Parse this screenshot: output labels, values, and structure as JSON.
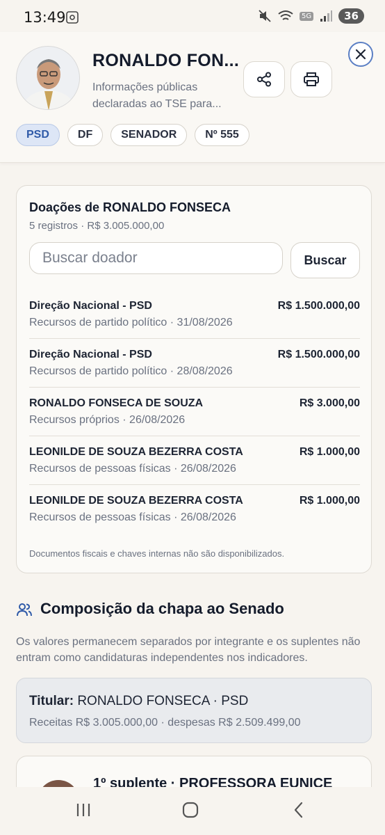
{
  "status_bar": {
    "time": "13:49",
    "network": "5G",
    "battery": "36"
  },
  "header": {
    "name": "RONALDO FON...",
    "subtitle": "Informações públicas declaradas ao TSE para...",
    "chips": [
      "PSD",
      "DF",
      "SENADOR",
      "Nº 555"
    ]
  },
  "donations": {
    "title": "Doações de RONALDO FONSECA",
    "meta": "5 registros · R$ 3.005.000,00",
    "search_placeholder": "Buscar doador",
    "search_button": "Buscar",
    "items": [
      {
        "name": "Direção Nacional - PSD",
        "amount": "R$ 1.500.000,00",
        "desc": "Recursos de partido político · 31/08/2026"
      },
      {
        "name": "Direção Nacional - PSD",
        "amount": "R$ 1.500.000,00",
        "desc": "Recursos de partido político · 28/08/2026"
      },
      {
        "name": "RONALDO FONSECA DE SOUZA",
        "amount": "R$ 3.000,00",
        "desc": "Recursos próprios · 26/08/2026"
      },
      {
        "name": "LEONILDE DE SOUZA BEZERRA COSTA",
        "amount": "R$ 1.000,00",
        "desc": "Recursos de pessoas físicas · 26/08/2026"
      },
      {
        "name": "LEONILDE DE SOUZA BEZERRA COSTA",
        "amount": "R$ 1.000,00",
        "desc": "Recursos de pessoas físicas · 26/08/2026"
      }
    ],
    "note": "Documentos fiscais e chaves internas não são disponibilizados."
  },
  "composition": {
    "title": "Composição da chapa ao Senado",
    "description": "Os valores permanecem separados por integrante e os suplentes não entram como candidaturas independentes nos indicadores.",
    "titular_label": "Titular:",
    "titular_name": "RONALDO FONSECA · PSD",
    "titular_sub": "Receitas R$ 3.005.000,00 · despesas R$ 2.509.499,00",
    "suplente_title": "1º suplente · PROFESSORA EUNICE"
  },
  "colors": {
    "accent": "#2f5aa8",
    "background": "#f7f4ef",
    "muted_text": "#6a7180"
  }
}
